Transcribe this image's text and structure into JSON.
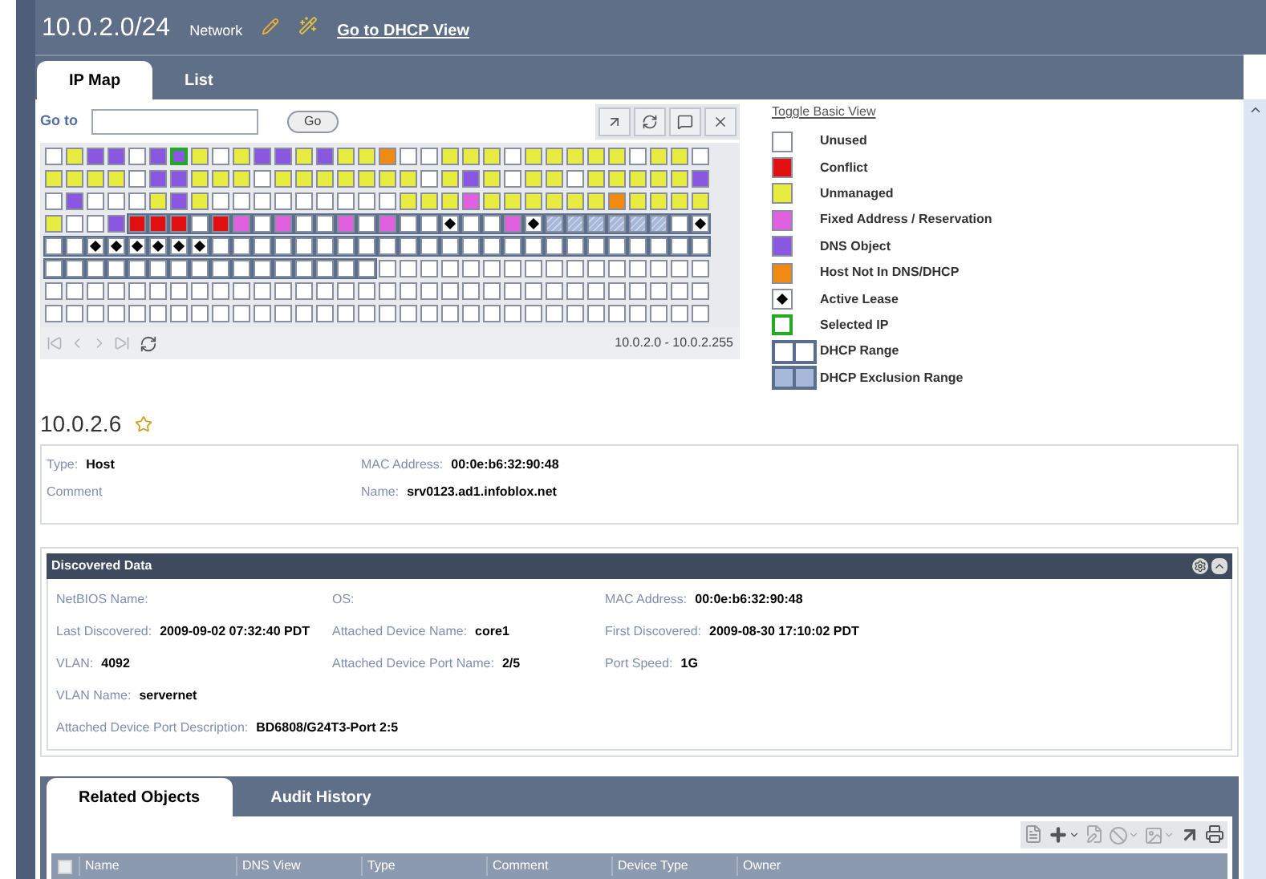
{
  "header": {
    "title": "10.0.2.0/24",
    "subtitle": "Network",
    "link": "Go to DHCP View"
  },
  "tabs": [
    {
      "label": "IP Map",
      "selected": true
    },
    {
      "label": "List",
      "selected": false
    }
  ],
  "goto": {
    "label": "Go to",
    "button": "Go"
  },
  "grid": [
    [
      {
        "kind": "unused"
      },
      {
        "kind": "unmanaged"
      },
      {
        "kind": "dns"
      },
      {
        "kind": "dns"
      },
      {
        "kind": "unused"
      },
      {
        "kind": "dns"
      },
      {
        "kind": "selected"
      },
      {
        "kind": "unmanaged"
      },
      {
        "kind": "unused"
      },
      {
        "kind": "unmanaged"
      },
      {
        "kind": "dns"
      },
      {
        "kind": "dns"
      },
      {
        "kind": "unmanaged"
      },
      {
        "kind": "dns"
      },
      {
        "kind": "unmanaged"
      },
      {
        "kind": "unmanaged"
      },
      {
        "kind": "host"
      },
      {
        "kind": "unused"
      },
      {
        "kind": "unused"
      },
      {
        "kind": "unmanaged"
      },
      {
        "kind": "unmanaged"
      },
      {
        "kind": "unmanaged"
      },
      {
        "kind": "unused"
      },
      {
        "kind": "unmanaged"
      },
      {
        "kind": "unmanaged"
      },
      {
        "kind": "unmanaged"
      },
      {
        "kind": "unmanaged"
      },
      {
        "kind": "unmanaged"
      },
      {
        "kind": "unused"
      },
      {
        "kind": "unmanaged"
      },
      {
        "kind": "unmanaged"
      },
      {
        "kind": "unused"
      }
    ],
    [
      {
        "kind": "unmanaged"
      },
      {
        "kind": "unmanaged"
      },
      {
        "kind": "unmanaged"
      },
      {
        "kind": "unmanaged"
      },
      {
        "kind": "unused"
      },
      {
        "kind": "dns"
      },
      {
        "kind": "dns"
      },
      {
        "kind": "unmanaged"
      },
      {
        "kind": "unmanaged"
      },
      {
        "kind": "unmanaged"
      },
      {
        "kind": "unused"
      },
      {
        "kind": "unmanaged"
      },
      {
        "kind": "unmanaged"
      },
      {
        "kind": "unmanaged"
      },
      {
        "kind": "unmanaged"
      },
      {
        "kind": "unmanaged"
      },
      {
        "kind": "unmanaged"
      },
      {
        "kind": "unmanaged"
      },
      {
        "kind": "unused"
      },
      {
        "kind": "unmanaged"
      },
      {
        "kind": "dns"
      },
      {
        "kind": "unmanaged"
      },
      {
        "kind": "unused"
      },
      {
        "kind": "unmanaged"
      },
      {
        "kind": "unmanaged"
      },
      {
        "kind": "unused"
      },
      {
        "kind": "unmanaged"
      },
      {
        "kind": "unmanaged"
      },
      {
        "kind": "unmanaged"
      },
      {
        "kind": "unmanaged"
      },
      {
        "kind": "unmanaged"
      },
      {
        "kind": "dns"
      }
    ],
    [
      {
        "kind": "unused"
      },
      {
        "kind": "dns"
      },
      {
        "kind": "unused"
      },
      {
        "kind": "unused"
      },
      {
        "kind": "unused"
      },
      {
        "kind": "unmanaged"
      },
      {
        "kind": "dns"
      },
      {
        "kind": "unmanaged"
      },
      {
        "kind": "unused"
      },
      {
        "kind": "unused"
      },
      {
        "kind": "unused"
      },
      {
        "kind": "unused"
      },
      {
        "kind": "unused"
      },
      {
        "kind": "unused"
      },
      {
        "kind": "unused"
      },
      {
        "kind": "unused"
      },
      {
        "kind": "unused"
      },
      {
        "kind": "unmanaged"
      },
      {
        "kind": "unmanaged"
      },
      {
        "kind": "unmanaged"
      },
      {
        "kind": "fixed"
      },
      {
        "kind": "unmanaged"
      },
      {
        "kind": "unmanaged"
      },
      {
        "kind": "unmanaged"
      },
      {
        "kind": "unmanaged"
      },
      {
        "kind": "unmanaged"
      },
      {
        "kind": "unmanaged"
      },
      {
        "kind": "host"
      },
      {
        "kind": "unmanaged"
      },
      {
        "kind": "unmanaged"
      },
      {
        "kind": "unmanaged"
      },
      {
        "kind": "unmanaged"
      }
    ],
    [
      {
        "kind": "unmanaged"
      },
      {
        "kind": "unused"
      },
      {
        "kind": "unused"
      },
      {
        "kind": "dns"
      },
      {
        "kind": "range-conflict"
      },
      {
        "kind": "range-conflict"
      },
      {
        "kind": "range-conflict"
      },
      {
        "kind": "range-unused"
      },
      {
        "kind": "range-conflict"
      },
      {
        "kind": "range-fixed"
      },
      {
        "kind": "range-unused"
      },
      {
        "kind": "range-fixed"
      },
      {
        "kind": "range-unused"
      },
      {
        "kind": "range-unused"
      },
      {
        "kind": "range-fixed"
      },
      {
        "kind": "range-unused"
      },
      {
        "kind": "range-fixed"
      },
      {
        "kind": "range-unused"
      },
      {
        "kind": "range-unused"
      },
      {
        "kind": "range-lease"
      },
      {
        "kind": "range-unused"
      },
      {
        "kind": "range-unused"
      },
      {
        "kind": "range-fixed"
      },
      {
        "kind": "range-lease"
      },
      {
        "kind": "range-exclusion"
      },
      {
        "kind": "range-exclusion"
      },
      {
        "kind": "range-exclusion"
      },
      {
        "kind": "range-exclusion"
      },
      {
        "kind": "range-exclusion"
      },
      {
        "kind": "range-exclusion"
      },
      {
        "kind": "range-unused"
      },
      {
        "kind": "range-lease"
      }
    ],
    [
      {
        "kind": "range-unused"
      },
      {
        "kind": "range-unused"
      },
      {
        "kind": "range-lease"
      },
      {
        "kind": "range-lease"
      },
      {
        "kind": "range-lease"
      },
      {
        "kind": "range-lease"
      },
      {
        "kind": "range-lease"
      },
      {
        "kind": "range-lease"
      },
      {
        "kind": "range-unused"
      },
      {
        "kind": "range-unused"
      },
      {
        "kind": "range-unused"
      },
      {
        "kind": "range-unused"
      },
      {
        "kind": "range-unused"
      },
      {
        "kind": "range-unused"
      },
      {
        "kind": "range-unused"
      },
      {
        "kind": "range-unused"
      },
      {
        "kind": "range-unused"
      },
      {
        "kind": "range-unused"
      },
      {
        "kind": "range-unused"
      },
      {
        "kind": "range-unused"
      },
      {
        "kind": "range-unused"
      },
      {
        "kind": "range-unused"
      },
      {
        "kind": "range-unused"
      },
      {
        "kind": "range-unused"
      },
      {
        "kind": "range-unused"
      },
      {
        "kind": "range-unused"
      },
      {
        "kind": "range-unused"
      },
      {
        "kind": "range-unused"
      },
      {
        "kind": "range-unused"
      },
      {
        "kind": "range-unused"
      },
      {
        "kind": "range-unused"
      },
      {
        "kind": "range-unused"
      }
    ],
    [
      {
        "kind": "range-unused"
      },
      {
        "kind": "range-unused"
      },
      {
        "kind": "range-unused"
      },
      {
        "kind": "range-unused"
      },
      {
        "kind": "range-unused"
      },
      {
        "kind": "range-unused"
      },
      {
        "kind": "range-unused"
      },
      {
        "kind": "range-unused"
      },
      {
        "kind": "range-unused"
      },
      {
        "kind": "range-unused"
      },
      {
        "kind": "range-unused"
      },
      {
        "kind": "range-unused"
      },
      {
        "kind": "range-unused"
      },
      {
        "kind": "range-unused"
      },
      {
        "kind": "range-unused"
      },
      {
        "kind": "range-unused"
      },
      {
        "kind": "unused"
      },
      {
        "kind": "unused"
      },
      {
        "kind": "unused"
      },
      {
        "kind": "unused"
      },
      {
        "kind": "unused"
      },
      {
        "kind": "unused"
      },
      {
        "kind": "unused"
      },
      {
        "kind": "unused"
      },
      {
        "kind": "unused"
      },
      {
        "kind": "unused"
      },
      {
        "kind": "unused"
      },
      {
        "kind": "unused"
      },
      {
        "kind": "unused"
      },
      {
        "kind": "unused"
      },
      {
        "kind": "unused"
      },
      {
        "kind": "unused"
      }
    ],
    [
      {
        "kind": "unused"
      },
      {
        "kind": "unused"
      },
      {
        "kind": "unused"
      },
      {
        "kind": "unused"
      },
      {
        "kind": "unused"
      },
      {
        "kind": "unused"
      },
      {
        "kind": "unused"
      },
      {
        "kind": "unused"
      },
      {
        "kind": "unused"
      },
      {
        "kind": "unused"
      },
      {
        "kind": "unused"
      },
      {
        "kind": "unused"
      },
      {
        "kind": "unused"
      },
      {
        "kind": "unused"
      },
      {
        "kind": "unused"
      },
      {
        "kind": "unused"
      },
      {
        "kind": "unused"
      },
      {
        "kind": "unused"
      },
      {
        "kind": "unused"
      },
      {
        "kind": "unused"
      },
      {
        "kind": "unused"
      },
      {
        "kind": "unused"
      },
      {
        "kind": "unused"
      },
      {
        "kind": "unused"
      },
      {
        "kind": "unused"
      },
      {
        "kind": "unused"
      },
      {
        "kind": "unused"
      },
      {
        "kind": "unused"
      },
      {
        "kind": "unused"
      },
      {
        "kind": "unused"
      },
      {
        "kind": "unused"
      },
      {
        "kind": "unused"
      }
    ],
    [
      {
        "kind": "unused"
      },
      {
        "kind": "unused"
      },
      {
        "kind": "unused"
      },
      {
        "kind": "unused"
      },
      {
        "kind": "unused"
      },
      {
        "kind": "unused"
      },
      {
        "kind": "unused"
      },
      {
        "kind": "unused"
      },
      {
        "kind": "unused"
      },
      {
        "kind": "unused"
      },
      {
        "kind": "unused"
      },
      {
        "kind": "unused"
      },
      {
        "kind": "unused"
      },
      {
        "kind": "unused"
      },
      {
        "kind": "unused"
      },
      {
        "kind": "unused"
      },
      {
        "kind": "unused"
      },
      {
        "kind": "unused"
      },
      {
        "kind": "unused"
      },
      {
        "kind": "unused"
      },
      {
        "kind": "unused"
      },
      {
        "kind": "unused"
      },
      {
        "kind": "unused"
      },
      {
        "kind": "unused"
      },
      {
        "kind": "unused"
      },
      {
        "kind": "unused"
      },
      {
        "kind": "unused"
      },
      {
        "kind": "unused"
      },
      {
        "kind": "unused"
      },
      {
        "kind": "unused"
      },
      {
        "kind": "unused"
      },
      {
        "kind": "unused"
      }
    ]
  ],
  "range_label": "10.0.2.0 - 10.0.2.255",
  "legend": {
    "toggle": "Toggle Basic View",
    "items": [
      {
        "kind": "unused",
        "label": "Unused"
      },
      {
        "kind": "conflict",
        "label": "Conflict"
      },
      {
        "kind": "unmanaged",
        "label": "Unmanaged"
      },
      {
        "kind": "fixed",
        "label": "Fixed Address / Reservation"
      },
      {
        "kind": "dns",
        "label": "DNS Object"
      },
      {
        "kind": "host",
        "label": "Host Not In DNS/DHCP"
      },
      {
        "kind": "lease",
        "label": "Active Lease"
      },
      {
        "kind": "selected-ip",
        "label": "Selected IP"
      },
      {
        "kind": "dhcp-range",
        "label": "DHCP Range"
      },
      {
        "kind": "exclusion-range",
        "label": "DHCP Exclusion Range"
      }
    ]
  },
  "address": {
    "title": "10.0.2.6",
    "fields": [
      {
        "label": "Type:",
        "value": "Host"
      },
      {
        "label": "MAC Address:",
        "value": "00:0e:b6:32:90:48"
      },
      {
        "label": "Comment"
      },
      {
        "label": "Name:",
        "value": "srv0123.ad1.infoblox.net"
      }
    ]
  },
  "discovered": {
    "title": "Discovered Data",
    "rows": [
      [
        {
          "label": "NetBIOS Name:"
        },
        {
          "label": "OS:"
        },
        {
          "label": "MAC Address:",
          "value": "00:0e:b6:32:90:48"
        }
      ],
      [
        {
          "label": "Last Discovered:",
          "value": "2009-09-02 07:32:40 PDT"
        },
        {
          "label": "Attached Device Name:",
          "value": "core1"
        },
        {
          "label": "First Discovered:",
          "value": "2009-08-30 17:10:02 PDT"
        }
      ],
      [
        {
          "label": "VLAN:",
          "value": "4092"
        },
        {
          "label": "Attached Device Port Name:",
          "value": "2/5"
        },
        {
          "label": "Port Speed:",
          "value": "1G"
        }
      ],
      [
        {
          "label": "VLAN Name:",
          "value": "servernet"
        }
      ],
      [
        {
          "label": "Attached Device Port Description:",
          "value": "BD6808/G24T3-Port 2:5"
        }
      ]
    ]
  },
  "related_tabs": [
    {
      "label": "Related Objects",
      "selected": true
    },
    {
      "label": "Audit History",
      "selected": false
    }
  ],
  "table": {
    "select_all_checked": false,
    "columns": [
      "Name",
      "DNS View",
      "Type",
      "Comment",
      "Device Type",
      "Owner"
    ]
  }
}
